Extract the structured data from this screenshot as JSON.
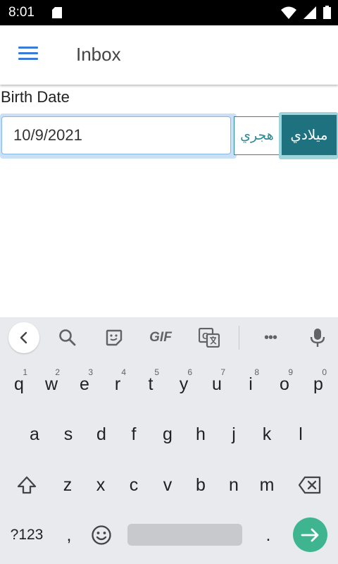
{
  "status_bar": {
    "time": "8:01"
  },
  "app_bar": {
    "title": "Inbox",
    "menu_icon": "hamburger-menu-icon"
  },
  "form": {
    "birth_date_label": "Birth Date",
    "date_value": "10/9/2021",
    "hijri_label": "هجري",
    "miladi_label": "ميلادي"
  },
  "keyboard": {
    "toolbar": [
      "back-icon",
      "search-icon",
      "sticker-icon",
      "GIF",
      "translate-icon",
      "more-icon",
      "mic-icon"
    ],
    "gif_label": "GIF",
    "more_label": "•••",
    "row1": [
      {
        "key": "q",
        "hint": "1"
      },
      {
        "key": "w",
        "hint": "2"
      },
      {
        "key": "e",
        "hint": "3"
      },
      {
        "key": "r",
        "hint": "4"
      },
      {
        "key": "t",
        "hint": "5"
      },
      {
        "key": "y",
        "hint": "6"
      },
      {
        "key": "u",
        "hint": "7"
      },
      {
        "key": "i",
        "hint": "8"
      },
      {
        "key": "o",
        "hint": "9"
      },
      {
        "key": "p",
        "hint": "0"
      }
    ],
    "row2": [
      "a",
      "s",
      "d",
      "f",
      "g",
      "h",
      "j",
      "k",
      "l"
    ],
    "row3": [
      "z",
      "x",
      "c",
      "v",
      "b",
      "n",
      "m"
    ],
    "symbols_label": "?123",
    "comma_label": ",",
    "period_label": ".",
    "accent_color": "#3fb58f"
  }
}
